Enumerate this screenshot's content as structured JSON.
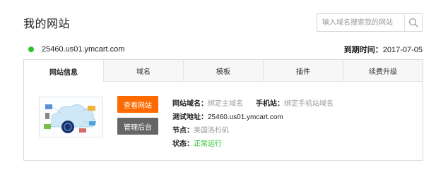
{
  "header": {
    "title": "我的网站",
    "search_placeholder": "输入域名搜索我的网站"
  },
  "site": {
    "domain": "25460.us01.ymcart.com",
    "expire_label": "到期时间：",
    "expire_date": "2017-07-05",
    "status_color": "#2fc12f"
  },
  "tabs": [
    {
      "label": "网站信息"
    },
    {
      "label": "域名"
    },
    {
      "label": "模板"
    },
    {
      "label": "插件"
    },
    {
      "label": "续费升级"
    }
  ],
  "actions": {
    "view_site": "查看网站",
    "admin": "管理后台"
  },
  "info": {
    "domain_label": "网站域名：",
    "domain_value": "绑定主域名",
    "mobile_label": "手机站：",
    "mobile_value": "绑定手机站域名",
    "test_label": "测试地址：",
    "test_value": "25460.us01.ymcart.com",
    "node_label": "节点：",
    "node_value": "美国洛杉矶",
    "status_label": "状态：",
    "status_value": "正常运行"
  },
  "colors": {
    "accent": "#ff6a00",
    "secondary_button": "#666666",
    "ok": "#2fc12f"
  }
}
